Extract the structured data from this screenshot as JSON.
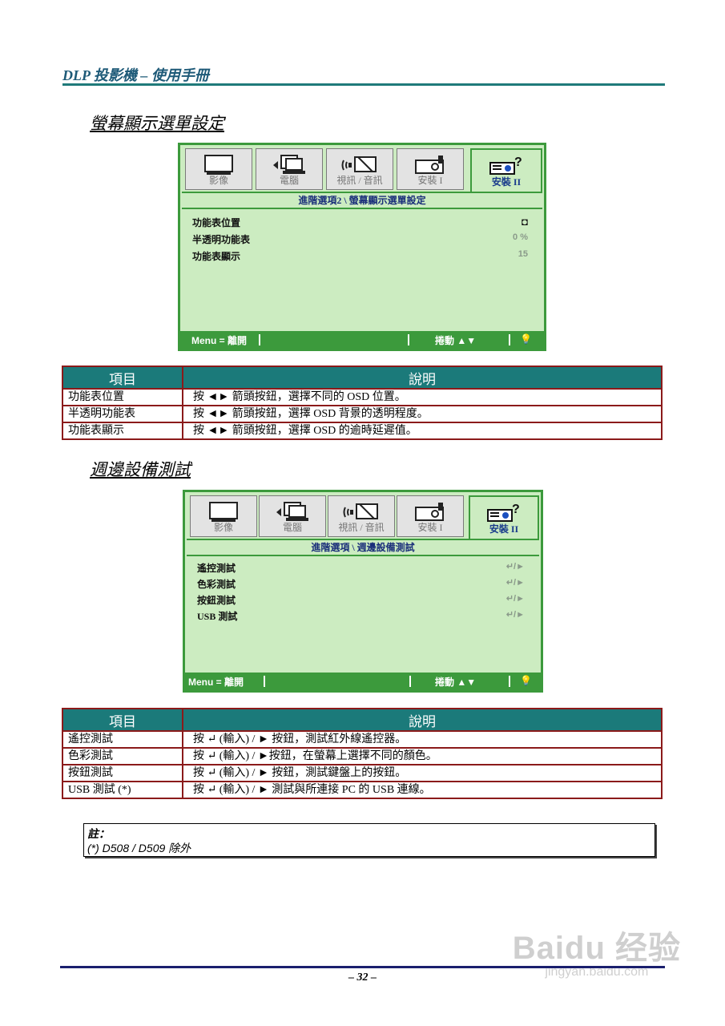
{
  "header": {
    "title": "DLP 投影機 – 使用手冊"
  },
  "section1": {
    "heading": "螢幕顯示選單設定",
    "osd": {
      "tabs": [
        {
          "label": "影像",
          "icon": "monitor-icon"
        },
        {
          "label": "電腦",
          "icon": "computer-icon"
        },
        {
          "label": "視訊 / 音訊",
          "icon": "video-audio-icon"
        },
        {
          "label": "安裝 I",
          "icon": "projector-icon"
        },
        {
          "label": "安裝 II",
          "icon": "projector-settings-icon",
          "active": true
        }
      ],
      "breadcrumb": "進階選項2 \\ 螢幕顯示選單設定",
      "rows": [
        {
          "label": "功能表位置",
          "value": "◘"
        },
        {
          "label": "半透明功能表",
          "value": "0 %"
        },
        {
          "label": "功能表顯示",
          "value": "15"
        }
      ],
      "footer": {
        "menu": "Menu = 離開",
        "scroll": "捲動 ▲▼",
        "lamp_icon": "lamp-icon"
      }
    },
    "table": {
      "headers": [
        "項目",
        "說明"
      ],
      "rows": [
        [
          "功能表位置",
          "按 ◄► 箭頭按鈕，選擇不同的 OSD 位置。"
        ],
        [
          "半透明功能表",
          "按 ◄► 箭頭按鈕，選擇 OSD 背景的透明程度。"
        ],
        [
          "功能表顯示",
          "按 ◄► 箭頭按鈕，選擇 OSD 的逾時延遲值。"
        ]
      ]
    }
  },
  "section2": {
    "heading": "週邊設備測試",
    "osd": {
      "tabs": [
        {
          "label": "影像",
          "icon": "monitor-icon"
        },
        {
          "label": "電腦",
          "icon": "computer-icon"
        },
        {
          "label": "視訊 / 音訊",
          "icon": "video-audio-icon"
        },
        {
          "label": "安裝 I",
          "icon": "projector-icon"
        },
        {
          "label": "安裝 II",
          "icon": "projector-settings-icon",
          "active": true
        }
      ],
      "breadcrumb": "進階選項 \\ 週邊設備測試",
      "rows": [
        {
          "label": "遙控測試",
          "value": "↵/►"
        },
        {
          "label": "色彩測試",
          "value": "↵/►"
        },
        {
          "label": "按鈕測試",
          "value": "↵/►"
        },
        {
          "label": "USB 測試",
          "value": "↵/►"
        }
      ],
      "footer": {
        "menu": "Menu = 離開",
        "scroll": "捲動 ▲▼",
        "lamp_icon": "lamp-icon"
      }
    },
    "table": {
      "headers": [
        "項目",
        "說明"
      ],
      "rows": [
        [
          "遙控測試",
          "按 ↵ (輸入) / ► 按鈕，測試紅外線遙控器。"
        ],
        [
          "色彩測試",
          "按 ↵ (輸入) / ►按鈕，在螢幕上選擇不同的顏色。"
        ],
        [
          "按鈕測試",
          "按 ↵ (輸入) / ► 按鈕，測試鍵盤上的按鈕。"
        ],
        [
          "USB 測試 (*)",
          "按 ↵ (輸入) / ► 測試與所連接 PC 的 USB 連線。"
        ]
      ]
    }
  },
  "note": {
    "title": "註：",
    "text": "(*) D508 / D509 除外"
  },
  "page_number": "– 32 –",
  "watermark": {
    "brand": "Baidu 经验",
    "url": "jingyan.baidu.com"
  }
}
